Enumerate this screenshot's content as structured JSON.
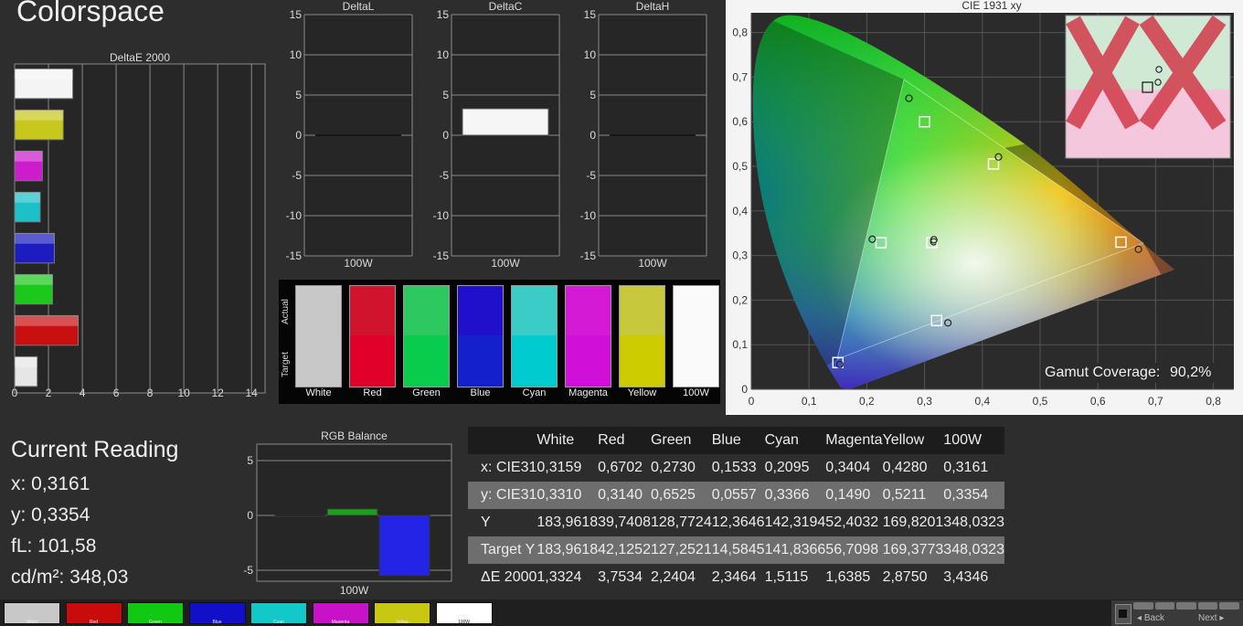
{
  "app": {
    "title": "Colorspace"
  },
  "delta_e": {
    "title": "DeltaE 2000",
    "ticks": [
      "0",
      "2",
      "4",
      "6",
      "8",
      "10",
      "12",
      "14"
    ],
    "bars": [
      {
        "value": 3.4346,
        "color": "#f4f4f4"
      },
      {
        "value": 2.875,
        "color": "#c8c81c"
      },
      {
        "value": 1.6385,
        "color": "#cc1ccc"
      },
      {
        "value": 1.5115,
        "color": "#1cc0c8"
      },
      {
        "value": 2.3464,
        "color": "#1c1cc0"
      },
      {
        "value": 2.2404,
        "color": "#1cc81c"
      },
      {
        "value": 3.7534,
        "color": "#c81010"
      },
      {
        "value": 1.3324,
        "color": "#e6e6e6"
      }
    ]
  },
  "delta_l": {
    "title": "DeltaL",
    "label": "100W",
    "ticks": [
      "15",
      "10",
      "5",
      "0",
      "-5",
      "-10",
      "-15"
    ],
    "value": 0
  },
  "delta_c": {
    "title": "DeltaC",
    "label": "100W",
    "ticks": [
      "15",
      "10",
      "5",
      "0",
      "-5",
      "-10",
      "-15"
    ],
    "value": 3.3
  },
  "delta_h": {
    "title": "DeltaH",
    "label": "100W",
    "ticks": [
      "15",
      "10",
      "5",
      "0",
      "-5",
      "-10",
      "-15"
    ],
    "value": 0
  },
  "swatches": {
    "actual_label": "Actual",
    "target_label": "Target",
    "items": [
      {
        "name": "White",
        "actual": "#c8c8c8",
        "target": "#c8c8c8"
      },
      {
        "name": "Red",
        "actual": "#d0142e",
        "target": "#e0002a"
      },
      {
        "name": "Green",
        "actual": "#2ec860",
        "target": "#0acc4c"
      },
      {
        "name": "Blue",
        "actual": "#2010cc",
        "target": "#1420cc"
      },
      {
        "name": "Cyan",
        "actual": "#3cccc8",
        "target": "#00ccd0"
      },
      {
        "name": "Magenta",
        "actual": "#d41ad4",
        "target": "#d010d8"
      },
      {
        "name": "Yellow",
        "actual": "#c8c83c",
        "target": "#cccc00"
      },
      {
        "name": "100W",
        "actual": "#fafafa",
        "target": "#fafafa"
      }
    ]
  },
  "cie": {
    "title": "CIE 1931 xy",
    "gamut_label": "Gamut Coverage:",
    "gamut_value": "90,2%",
    "x_ticks": [
      "0",
      "0,1",
      "0,2",
      "0,3",
      "0,4",
      "0,5",
      "0,6",
      "0,7",
      "0,8"
    ],
    "y_ticks": [
      "0",
      "0,1",
      "0,2",
      "0,3",
      "0,4",
      "0,5",
      "0,6",
      "0,7",
      "0,8"
    ]
  },
  "current": {
    "title": "Current Reading",
    "x": "x: 0,3161",
    "y": "y: 0,3354",
    "fl": "fL: 101,58",
    "cdm": "cd/m²: 348,03"
  },
  "rgb_balance": {
    "title": "RGB Balance",
    "label": "100W",
    "ticks": [
      "5",
      "0",
      "-5"
    ],
    "values": [
      {
        "color": "#1a1a1a",
        "value": 0
      },
      {
        "color": "#1ca01c",
        "value": 0.6
      },
      {
        "color": "#2424e6",
        "value": -5.5
      }
    ]
  },
  "table": {
    "headers": [
      "",
      "White",
      "Red",
      "Green",
      "Blue",
      "Cyan",
      "Magenta",
      "Yellow",
      "100W"
    ],
    "rows": [
      [
        "x: CIE31",
        "0,3159",
        "0,6702",
        "0,2730",
        "0,1533",
        "0,2095",
        "0,3404",
        "0,4280",
        "0,3161"
      ],
      [
        "y: CIE31",
        "0,3310",
        "0,3140",
        "0,6525",
        "0,0557",
        "0,3366",
        "0,1490",
        "0,5211",
        "0,3354"
      ],
      [
        "Y",
        "183,9618",
        "39,7408",
        "128,7724",
        "12,3646",
        "142,3194",
        "52,4032",
        "169,8201",
        "348,0323"
      ],
      [
        "Target Y",
        "183,9618",
        "42,1252",
        "127,2521",
        "14,5845",
        "141,8366",
        "56,7098",
        "169,3773",
        "348,0323"
      ],
      [
        "ΔE 2000",
        "1,3324",
        "3,7534",
        "2,2404",
        "2,3464",
        "1,5115",
        "1,6385",
        "2,8750",
        "3,4346"
      ]
    ]
  },
  "bottom_bar": {
    "buttons": [
      {
        "label": "White",
        "color": "#c8c8c8"
      },
      {
        "label": "Red",
        "color": "#c80c0c"
      },
      {
        "label": "Green",
        "color": "#12c812"
      },
      {
        "label": "Blue",
        "color": "#1010c8"
      },
      {
        "label": "Cyan",
        "color": "#12c8c8"
      },
      {
        "label": "Magenta",
        "color": "#c812c8"
      },
      {
        "label": "Yellow",
        "color": "#c8c812"
      },
      {
        "label": "100W",
        "color": "#ffffff"
      }
    ],
    "back": "Back",
    "next": "Next"
  }
}
